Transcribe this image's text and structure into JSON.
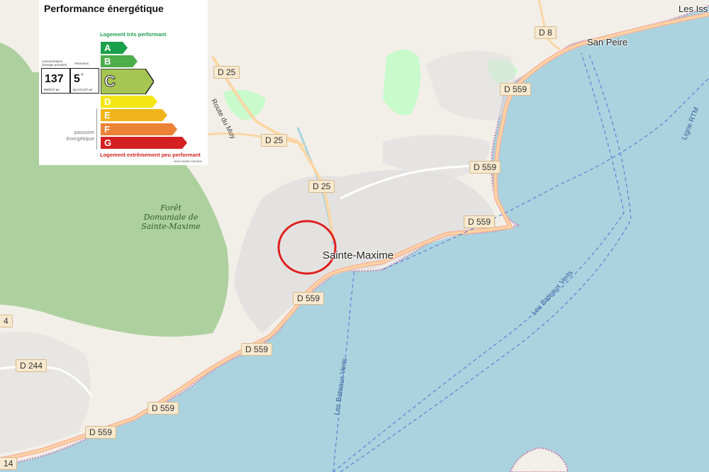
{
  "map": {
    "town": "Sainte-Maxime",
    "village": "San Peire",
    "edge_town": "Les Iss",
    "forest": "Forêt Domaniale de Sainte-Maxime",
    "roads": {
      "d8": "D 8",
      "d25_a": "D 25",
      "d25_b": "D 25",
      "d25_c": "D 25",
      "d559_a": "D 559",
      "d559_b": "D 559",
      "d559_c": "D 559",
      "d559_d": "D 559",
      "d559_e": "D 559",
      "d559_f": "D 559",
      "d559_g": "D 559",
      "d244": "D 244",
      "edge_14": "14",
      "edge_4": "4",
      "route_muy": "Route du Muy"
    },
    "ferries": {
      "a": "Les Bateaux Verts",
      "b": "Les Bateaux Verts",
      "rtm": "Ligne RTM"
    },
    "colors": {
      "sea": "#aad3df",
      "land": "#f2efe9",
      "forest": "#add19e",
      "park": "#c8facc",
      "urban": "#e0dfdf",
      "highlight_circle": "#e01e1e"
    }
  },
  "dpe": {
    "title": "Performance énergétique",
    "top_label": "Logement très performant",
    "bottom_label": "Logement extrêmement peu performant",
    "consumption_caption": "consommation\n(énergie primaire)",
    "emission_caption": "émissions",
    "consumption_value": "137",
    "consumption_unit": "kWh/m².an",
    "emission_value": "5",
    "emission_star": "*",
    "emission_unit": "kg CO₂/m².an",
    "passoire": "passoire énergétique",
    "footer": "www.sainte-maxime",
    "current_class": "C",
    "classes": [
      {
        "letter": "A",
        "color": "#1a9f4a"
      },
      {
        "letter": "B",
        "color": "#4cad4b"
      },
      {
        "letter": "C",
        "color": "#a5c653"
      },
      {
        "letter": "D",
        "color": "#f4e614"
      },
      {
        "letter": "E",
        "color": "#f0b41a"
      },
      {
        "letter": "F",
        "color": "#ec8235"
      },
      {
        "letter": "G",
        "color": "#d42020"
      }
    ]
  }
}
